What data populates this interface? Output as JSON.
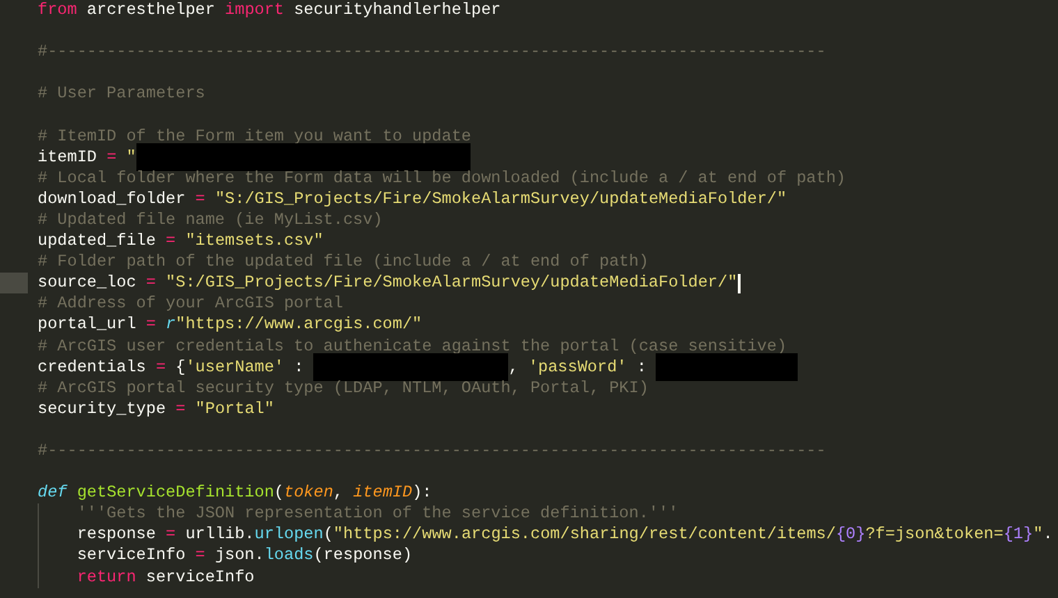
{
  "editor": {
    "lines": [
      {
        "current": false,
        "tokens": [
          {
            "kind": "keyword",
            "text": "from"
          },
          {
            "kind": "plain",
            "text": " arcresthelper "
          },
          {
            "kind": "keyword",
            "text": "import"
          },
          {
            "kind": "plain",
            "text": " securityhandlerhelper"
          }
        ]
      },
      {
        "current": false
      },
      {
        "current": false,
        "tokens": [
          {
            "kind": "comment",
            "text": "#-------------------------------------------------------------------------------"
          }
        ]
      },
      {
        "current": false
      },
      {
        "current": false,
        "tokens": [
          {
            "kind": "comment",
            "text": "# User Parameters"
          }
        ]
      },
      {
        "current": false
      },
      {
        "current": false,
        "tokens": [
          {
            "kind": "comment",
            "text": "# ItemID of the Form item you want to update"
          }
        ]
      },
      {
        "current": false,
        "tokens": [
          {
            "kind": "plain",
            "text": "itemID "
          },
          {
            "kind": "operator",
            "text": "="
          },
          {
            "kind": "string",
            "text": " \""
          },
          {
            "kind": "redacted"
          }
        ]
      },
      {
        "current": false,
        "tokens": [
          {
            "kind": "comment",
            "text": "# Local folder where the Form data will be downloaded (include a / at end of path)"
          }
        ]
      },
      {
        "current": false,
        "tokens": [
          {
            "kind": "plain",
            "text": "download_folder "
          },
          {
            "kind": "operator",
            "text": "="
          },
          {
            "kind": "string",
            "text": " \"S:/GIS_Projects/Fire/SmokeAlarmSurvey/updateMediaFolder/\""
          }
        ]
      },
      {
        "current": false,
        "tokens": [
          {
            "kind": "comment",
            "text": "# Updated file name (ie MyList.csv)"
          }
        ]
      },
      {
        "current": false,
        "tokens": [
          {
            "kind": "plain",
            "text": "updated_file "
          },
          {
            "kind": "operator",
            "text": "="
          },
          {
            "kind": "string",
            "text": " \"itemsets.csv\""
          }
        ]
      },
      {
        "current": false,
        "tokens": [
          {
            "kind": "comment",
            "text": "# Folder path of the updated file (include a / at end of path)"
          }
        ]
      },
      {
        "current": true,
        "tokens": [
          {
            "kind": "plain",
            "text": "source_loc "
          },
          {
            "kind": "operator",
            "text": "="
          },
          {
            "kind": "string",
            "text": " \"S:/GIS_Projects/Fire/SmokeAlarmSurvey/updateMediaFolder/\""
          }
        ]
      },
      {
        "current": false,
        "tokens": [
          {
            "kind": "comment",
            "text": "# Address of your ArcGIS portal"
          }
        ]
      },
      {
        "current": false,
        "tokens": [
          {
            "kind": "plain",
            "text": "portal_url "
          },
          {
            "kind": "operator",
            "text": "="
          },
          {
            "kind": "storage",
            "text": " r"
          },
          {
            "kind": "string",
            "text": "\"https://www.arcgis.com/\""
          }
        ]
      },
      {
        "current": false,
        "tokens": [
          {
            "kind": "comment",
            "text": "# ArcGIS user credentials to authenicate against the portal (case sensitive)"
          }
        ]
      },
      {
        "current": false,
        "tokens": [
          {
            "kind": "plain",
            "text": "credentials "
          },
          {
            "kind": "operator",
            "text": "="
          },
          {
            "kind": "plain",
            "text": " {"
          },
          {
            "kind": "string",
            "text": "'userName'"
          },
          {
            "kind": "plain",
            "text": " : "
          },
          {
            "kind": "redacted"
          },
          {
            "kind": "plain",
            "text": ", "
          },
          {
            "kind": "string",
            "text": "'passWord'"
          },
          {
            "kind": "plain",
            "text": " : "
          },
          {
            "kind": "redacted"
          }
        ]
      },
      {
        "current": false,
        "tokens": [
          {
            "kind": "comment",
            "text": "# ArcGIS portal security type (LDAP, NTLM, OAuth, Portal, PKI)"
          }
        ]
      },
      {
        "current": false,
        "tokens": [
          {
            "kind": "plain",
            "text": "security_type "
          },
          {
            "kind": "operator",
            "text": "="
          },
          {
            "kind": "string",
            "text": " \"Portal\""
          }
        ]
      },
      {
        "current": false
      },
      {
        "current": false,
        "tokens": [
          {
            "kind": "comment",
            "text": "#-------------------------------------------------------------------------------"
          }
        ]
      },
      {
        "current": false
      },
      {
        "current": false,
        "tokens": [
          {
            "kind": "storage",
            "text": "def"
          },
          {
            "kind": "function",
            "text": " getServiceDefinition"
          },
          {
            "kind": "plain",
            "text": "("
          },
          {
            "kind": "param",
            "text": "token"
          },
          {
            "kind": "plain",
            "text": ", "
          },
          {
            "kind": "param",
            "text": "itemID"
          },
          {
            "kind": "plain",
            "text": "):"
          }
        ]
      },
      {
        "current": false,
        "guide": true,
        "tokens": [
          {
            "kind": "comment",
            "text": "'''Gets the JSON representation of the service definition.'''"
          }
        ]
      },
      {
        "current": false,
        "guide": true,
        "tokens": [
          {
            "kind": "plain",
            "text": "response "
          },
          {
            "kind": "operator",
            "text": "="
          },
          {
            "kind": "plain",
            "text": " urllib."
          },
          {
            "kind": "method",
            "text": "urlopen"
          },
          {
            "kind": "plain",
            "text": "("
          },
          {
            "kind": "string",
            "text": "\"https://www.arcgis.com/sharing/rest/content/items/"
          },
          {
            "kind": "constant",
            "text": "{0}"
          },
          {
            "kind": "string",
            "text": "?f=json&token="
          },
          {
            "kind": "constant",
            "text": "{1}"
          },
          {
            "kind": "string",
            "text": "\""
          },
          {
            "kind": "plain",
            "text": "."
          }
        ]
      },
      {
        "current": false,
        "guide": true,
        "tokens": [
          {
            "kind": "plain",
            "text": "serviceInfo "
          },
          {
            "kind": "operator",
            "text": "="
          },
          {
            "kind": "plain",
            "text": " json."
          },
          {
            "kind": "method",
            "text": "loads"
          },
          {
            "kind": "plain",
            "text": "(response)"
          }
        ]
      },
      {
        "current": false,
        "guide": true,
        "tokens": [
          {
            "kind": "keyword",
            "text": "return"
          },
          {
            "kind": "plain",
            "text": " serviceInfo"
          }
        ]
      },
      {
        "current": false
      }
    ]
  }
}
